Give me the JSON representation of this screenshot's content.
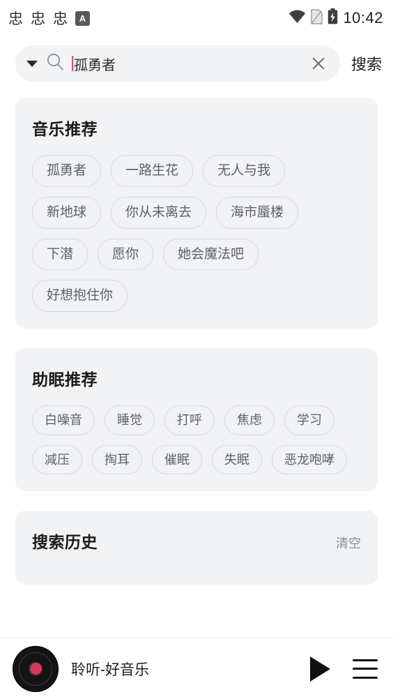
{
  "statusbar": {
    "glyphs": [
      "忠",
      "忠",
      "忠"
    ],
    "app_badge": "A",
    "icons": [
      "wifi-icon",
      "sim-card-icon",
      "battery-icon"
    ],
    "clock": "10:42"
  },
  "search": {
    "dropdown_icon": "chevron-down-icon",
    "search_icon": "search-icon",
    "value": "孤勇者",
    "placeholder": "",
    "clear_icon": "close-icon",
    "button_label": "搜索"
  },
  "sections": [
    {
      "id": "music-recommend",
      "title": "音乐推荐",
      "chips": [
        "孤勇者",
        "一路生花",
        "无人与我",
        "新地球",
        "你从未离去",
        "海市蜃楼",
        "下潜",
        "愿你",
        "她会魔法吧",
        "好想抱住你"
      ]
    },
    {
      "id": "sleep-recommend",
      "title": "助眠推荐",
      "chips": [
        "白噪音",
        "睡觉",
        "打呼",
        "焦虑",
        "学习",
        "减压",
        "掏耳",
        "催眠",
        "失眠",
        "恶龙咆哮"
      ]
    },
    {
      "id": "search-history",
      "title": "搜索历史",
      "action_label": "清空",
      "chips": []
    }
  ],
  "player": {
    "album_icon": "vinyl-disc-icon",
    "track_title": "聆听-好音乐",
    "play_icon": "play-icon",
    "playlist_icon": "playlist-icon"
  }
}
